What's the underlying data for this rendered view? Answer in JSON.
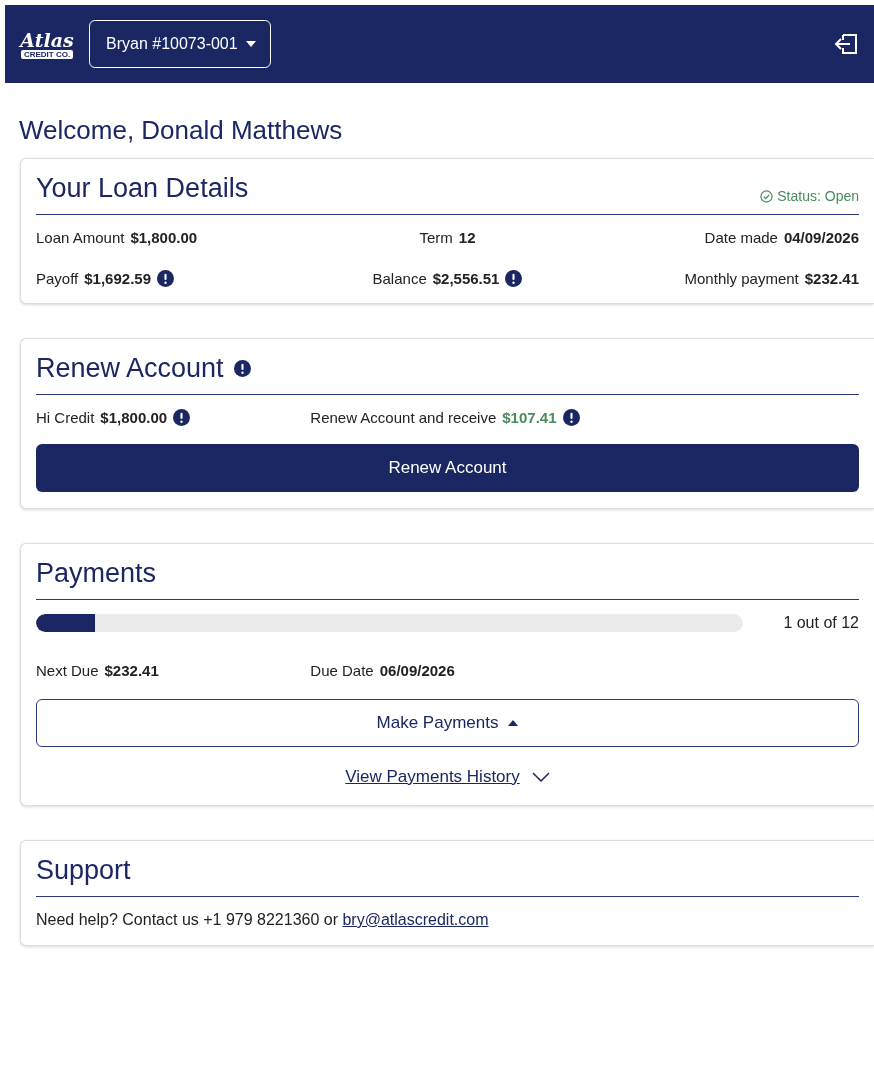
{
  "header": {
    "logo": {
      "script": "Atlas",
      "banner": "CREDIT CO."
    },
    "account_selector": "Bryan #10073-001"
  },
  "welcome": "Welcome, Donald Matthews",
  "loan_details": {
    "title": "Your Loan Details",
    "status": "Status: Open",
    "rows": [
      [
        {
          "label": "Loan Amount",
          "value": "$1,800.00",
          "info": false
        },
        {
          "label": "Term",
          "value": "12",
          "info": false
        },
        {
          "label": "Date made",
          "value": "04/09/2026",
          "info": false
        }
      ],
      [
        {
          "label": "Payoff",
          "value": "$1,692.59",
          "info": true
        },
        {
          "label": "Balance",
          "value": "$2,556.51",
          "info": true
        },
        {
          "label": "Monthly payment",
          "value": "$232.41",
          "info": false
        }
      ]
    ]
  },
  "renew": {
    "title": "Renew Account",
    "title_info": true,
    "fields": [
      {
        "label": "Hi Credit",
        "value": "$1,800.00",
        "info": true,
        "color": "#222222"
      },
      {
        "label": "Renew Account and receive",
        "value": "$107.41",
        "info": true,
        "color": "#4a8a5c"
      }
    ],
    "button": "Renew Account"
  },
  "payments": {
    "title": "Payments",
    "progress": {
      "level": 0.083,
      "text": "1 out of 12"
    },
    "fields": [
      {
        "label": "Next Due",
        "value": "$232.41"
      },
      {
        "label": "Due Date",
        "value": "06/09/2026"
      }
    ],
    "make_payments_button": "Make Payments",
    "history_link": "View Payments History"
  },
  "support": {
    "title": "Support",
    "text": "Need help? Contact us +1 979 8221360 or",
    "email": "bry@atlascredit.com"
  }
}
